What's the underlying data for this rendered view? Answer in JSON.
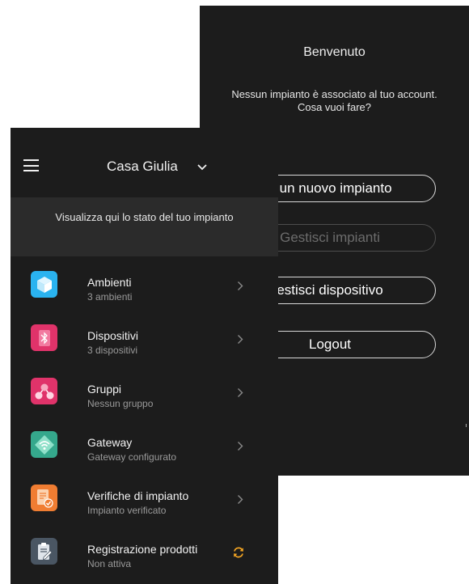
{
  "welcome": {
    "title": "Benvenuto",
    "message_line1": "Nessun impianto è associato al tuo account.",
    "message_line2": "Cosa vuoi fare?",
    "buttons": [
      {
        "label": "a un nuovo impianto",
        "enabled": true
      },
      {
        "label": "Gestisci impianti",
        "enabled": false
      },
      {
        "label": "estisci dispositivo",
        "enabled": true
      },
      {
        "label": "Logout",
        "enabled": true
      }
    ]
  },
  "home": {
    "title": "Casa Giulia",
    "status_text": "Visualizza qui lo stato del tuo impianto",
    "items": [
      {
        "name": "Ambienti",
        "sub": "3 ambienti",
        "icon": "cube-icon",
        "color": "#2ab3f0",
        "action": "chevron"
      },
      {
        "name": "Dispositivi",
        "sub": "3 dispositivi",
        "icon": "bluetooth-icon",
        "color": "#e0336a",
        "action": "chevron"
      },
      {
        "name": "Gruppi",
        "sub": "Nessun gruppo",
        "icon": "group-icon",
        "color": "#e0336a",
        "action": "chevron"
      },
      {
        "name": "Gateway",
        "sub": "Gateway configurato",
        "icon": "wifi-icon",
        "color": "#35a88c",
        "action": "chevron"
      },
      {
        "name": "Verifiche di impianto",
        "sub": "Impianto verificato",
        "icon": "document-check-icon",
        "color": "#f07d32",
        "action": "chevron"
      },
      {
        "name": "Registrazione prodotti",
        "sub": "Non attiva",
        "icon": "clipboard-edit-icon",
        "color": "#4a5663",
        "action": "sync"
      }
    ],
    "sync_color": "#f5a623"
  }
}
